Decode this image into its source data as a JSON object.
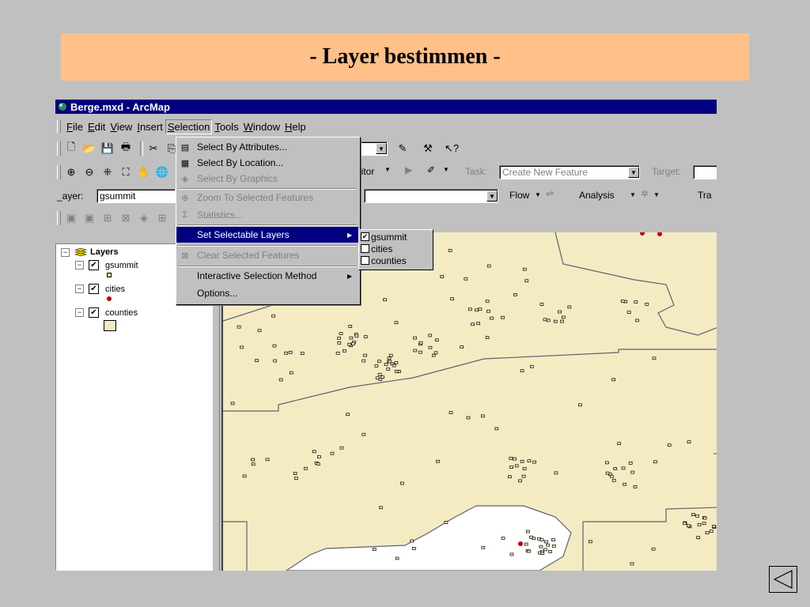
{
  "slide_title": "- Layer bestimmen -",
  "window": {
    "title": "Berge.mxd - ArcMap"
  },
  "menubar": [
    {
      "pre": "",
      "u": "F",
      "post": "ile"
    },
    {
      "pre": "",
      "u": "E",
      "post": "dit"
    },
    {
      "pre": "",
      "u": "V",
      "post": "iew"
    },
    {
      "pre": "",
      "u": "I",
      "post": "nsert"
    },
    {
      "pre": "",
      "u": "S",
      "post": "election"
    },
    {
      "pre": "",
      "u": "T",
      "post": "ools"
    },
    {
      "pre": "",
      "u": "W",
      "post": "indow"
    },
    {
      "pre": "",
      "u": "H",
      "post": "elp"
    }
  ],
  "editor": {
    "label": "litor",
    "task_label": "Task:",
    "task_value": "Create New Feature",
    "target_label": "Target:"
  },
  "layer_bar": {
    "label": "_ayer:",
    "value": "gsummit"
  },
  "network_bar": {
    "flow": "Flow",
    "analysis": "Analysis",
    "tra": "Tra"
  },
  "toc": {
    "root": "Layers",
    "layers": [
      {
        "name": "gsummit",
        "symbol_color": "#e8e070"
      },
      {
        "name": "cities",
        "symbol_color": "#c00000"
      },
      {
        "name": "counties",
        "symbol_color": "#f5ebc3"
      }
    ]
  },
  "selection_menu": {
    "items": [
      {
        "label": "Select By Attributes...",
        "icon": "select-by-attributes-icon",
        "enabled": true
      },
      {
        "label": "Select By Location...",
        "icon": "select-by-location-icon",
        "enabled": true
      },
      {
        "label": "Select By Graphics",
        "icon": "select-by-graphics-icon",
        "enabled": false
      },
      {
        "label": "Zoom To Selected Features",
        "icon": "zoom-to-selected-icon",
        "enabled": false
      },
      {
        "label": "Statistics...",
        "icon": "sigma-icon",
        "enabled": false
      },
      {
        "label": "Set Selectable Layers",
        "icon": "",
        "enabled": true,
        "highlighted": true,
        "submenu": true
      },
      {
        "label": "Clear Selected Features",
        "icon": "clear-selection-icon",
        "enabled": false
      },
      {
        "label": "Interactive Selection Method",
        "icon": "",
        "enabled": true,
        "submenu": true
      },
      {
        "label": "Options...",
        "icon": "",
        "enabled": true
      }
    ]
  },
  "selectable_layers": [
    {
      "name": "gsummit",
      "checked": true
    },
    {
      "name": "cities",
      "checked": false
    },
    {
      "name": "counties",
      "checked": false
    }
  ],
  "colors": {
    "title_bg": "#ffc08a",
    "titlebar": "#000080",
    "map_bg": "#f5ebc3",
    "highlight": "#000080"
  }
}
